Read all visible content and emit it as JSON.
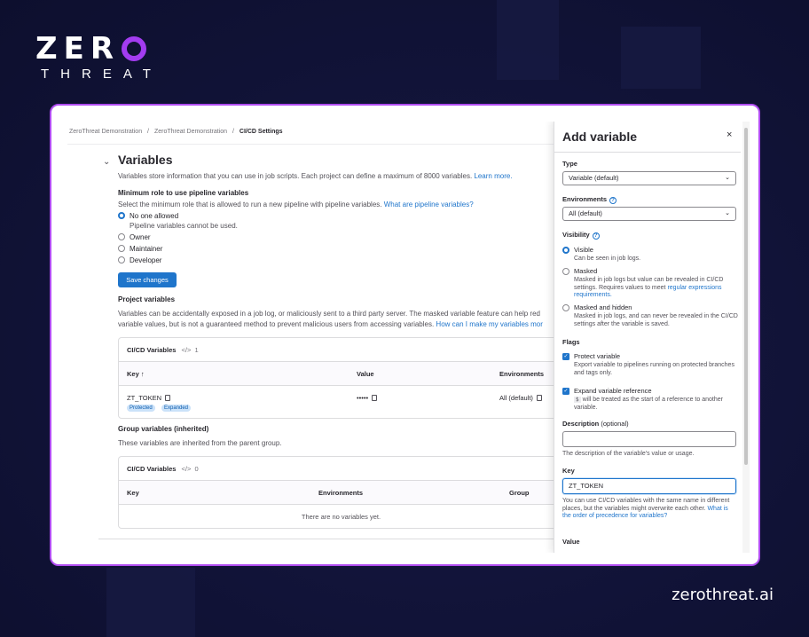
{
  "brand": {
    "logo_word": "ZER",
    "logo_sub": "THREAT",
    "url": "zerothreat.ai"
  },
  "breadcrumb": {
    "items": [
      "ZeroThreat Demonstration",
      "ZeroThreat Demonstration"
    ],
    "current": "CI/CD Settings",
    "separator": "/"
  },
  "variables_section": {
    "title": "Variables",
    "desc": "Variables store information that you can use in job scripts. Each project can define a maximum of 8000 variables.",
    "learn_more": "Learn more.",
    "min_role_title": "Minimum role to use pipeline variables",
    "min_role_desc": "Select the minimum role that is allowed to run a new pipeline with pipeline variables.",
    "min_role_link": "What are pipeline variables?",
    "roles": [
      {
        "label": "No one allowed",
        "help": "Pipeline variables cannot be used.",
        "selected": true
      },
      {
        "label": "Owner",
        "selected": false
      },
      {
        "label": "Maintainer",
        "selected": false
      },
      {
        "label": "Developer",
        "selected": false
      }
    ],
    "save_label": "Save changes",
    "project_vars_title": "Project variables",
    "project_vars_desc_1": "Variables can be accidentally exposed in a job log, or maliciously sent to a third party server. The masked variable feature can help red",
    "project_vars_desc_2": "variable values, but is not a guaranteed method to prevent malicious users from accessing variables.",
    "project_vars_link": "How can I make my variables mor"
  },
  "project_table": {
    "title": "CI/CD Variables",
    "count_icon": "</>",
    "count": "1",
    "columns": [
      "Key ↑",
      "Value",
      "Environments"
    ],
    "rows": [
      {
        "key": "ZT_TOKEN",
        "value": "•••••",
        "env": "All (default)",
        "badges": [
          "Protected",
          "Expanded"
        ]
      }
    ]
  },
  "group_section": {
    "title": "Group variables (inherited)",
    "desc": "These variables are inherited from the parent group."
  },
  "group_table": {
    "title": "CI/CD Variables",
    "count_icon": "</>",
    "count": "0",
    "columns": [
      "Key",
      "Environments",
      "Group"
    ],
    "empty": "There are no variables yet."
  },
  "drawer": {
    "title": "Add variable",
    "close": "×",
    "type_label": "Type",
    "type_value": "Variable (default)",
    "env_label": "Environments",
    "env_value": "All (default)",
    "visibility_label": "Visibility",
    "visibility": [
      {
        "label": "Visible",
        "help": "Can be seen in job logs.",
        "selected": true
      },
      {
        "label": "Masked",
        "help": "Masked in job logs but value can be revealed in CI/CD settings. Requires values to meet",
        "link": "regular expressions requirements.",
        "selected": false
      },
      {
        "label": "Masked and hidden",
        "help": "Masked in job logs, and can never be revealed in the CI/CD settings after the variable is saved.",
        "selected": false
      }
    ],
    "flags_label": "Flags",
    "flags": [
      {
        "label": "Protect variable",
        "help": "Export variable to pipelines running on protected branches and tags only.",
        "checked": true
      },
      {
        "label": "Expand variable reference",
        "code": "$",
        "help": "will be treated as the start of a reference to another variable.",
        "checked": true
      }
    ],
    "desc_label": "Description",
    "desc_optional": "(optional)",
    "desc_value": "",
    "desc_help": "The description of the variable's value or usage.",
    "key_label": "Key",
    "key_value": "ZT_TOKEN",
    "key_help": "You can use CI/CD variables with the same name in different places, but the variables might overwrite each other.",
    "key_link": "What is the order of precedence for variables?",
    "value_label": "Value"
  },
  "colors": {
    "accent": "#1f75cb",
    "brand_purple": "#a33cf0",
    "background": "#0f1132"
  }
}
